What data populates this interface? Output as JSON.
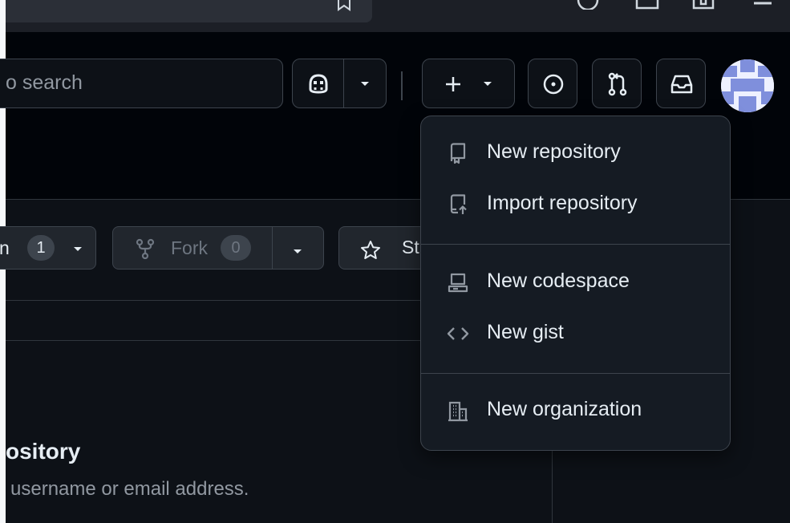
{
  "header": {
    "search_placeholder": "o search",
    "create_plus": "+",
    "avatar": "user-avatar"
  },
  "repo_actions": {
    "watch_label": "n",
    "watch_count": "1",
    "fork_label": "Fork",
    "fork_count": "0",
    "star_label": "St"
  },
  "main": {
    "title": "ository",
    "subtitle": "username or email address."
  },
  "create_menu": {
    "items": [
      {
        "label": "New repository",
        "icon": "repo-icon"
      },
      {
        "label": "Import repository",
        "icon": "repo-push-icon"
      },
      {
        "label": "New codespace",
        "icon": "codespaces-icon"
      },
      {
        "label": "New gist",
        "icon": "code-icon"
      },
      {
        "label": "New organization",
        "icon": "organization-icon"
      }
    ]
  },
  "colors": {
    "background": "#0d1117",
    "header": "#010409",
    "border": "#3d444d",
    "menu_bg": "#151b23",
    "text": "#e6edf3",
    "muted": "#9198a1"
  }
}
